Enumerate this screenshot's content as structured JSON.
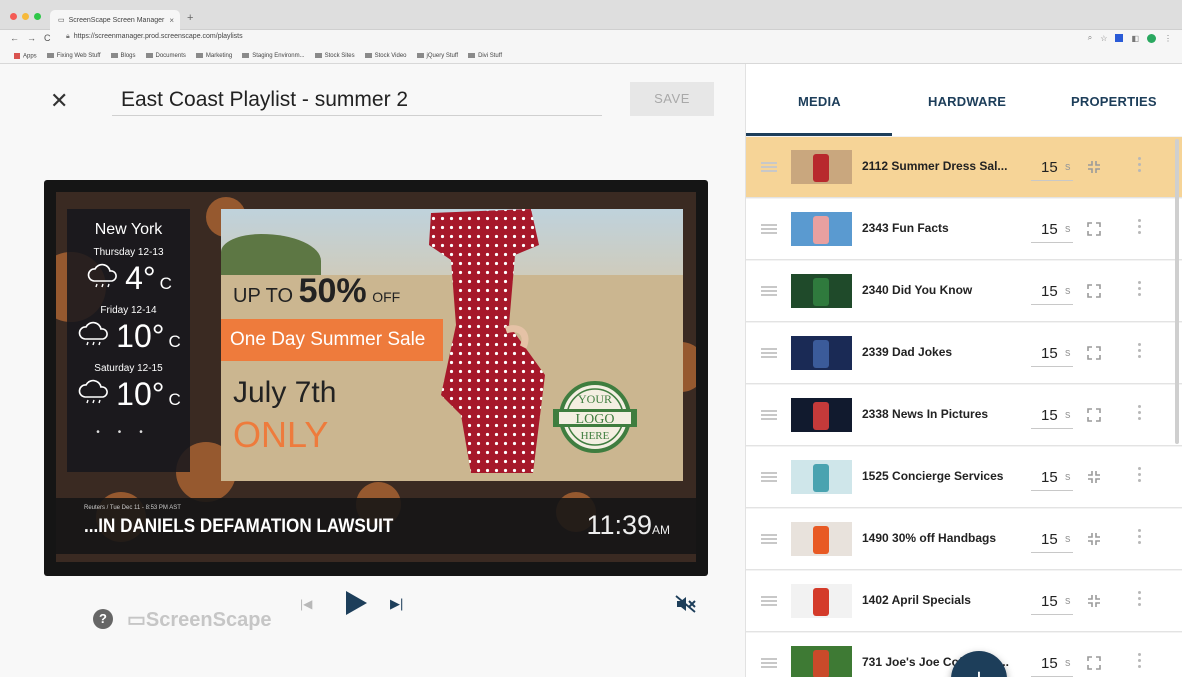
{
  "browser": {
    "tab_title": "ScreenScape Screen Manager",
    "url": "https://screenmanager.prod.screenscape.com/playlists",
    "bookmarks": [
      "Apps",
      "Fixing Web Stuff",
      "Blogs",
      "Documents",
      "Marketing",
      "Staging Environm...",
      "Stock Sites",
      "Stock Video",
      "jQuery Stuff",
      "Divi Stuff"
    ]
  },
  "editor": {
    "playlist_title": "East Coast Playlist - summer 2",
    "save_label": "SAVE"
  },
  "preview": {
    "weather": {
      "city": "New York",
      "days": [
        {
          "day": "Thursday 12-13",
          "temp": "4°",
          "unit": "C"
        },
        {
          "day": "Friday 12-14",
          "temp": "10°",
          "unit": "C"
        },
        {
          "day": "Saturday 12-15",
          "temp": "10°",
          "unit": "C"
        }
      ]
    },
    "ad": {
      "up_to": "UP TO",
      "percent": "50%",
      "off": "OFF",
      "band": "One Day Summer Sale",
      "date": "July 7th",
      "only": "ONLY",
      "logo_lines": [
        "YOUR",
        "LOGO",
        "HERE"
      ]
    },
    "ticker": {
      "source": "Reuters / Tue Dec 11 - 8:53 PM AST",
      "headline": "...IN DANIELS DEFAMATION LAWSUIT",
      "time": "11:39",
      "ampm": "AM"
    }
  },
  "player": {
    "brand": "ScreenScape"
  },
  "panel": {
    "tabs": [
      "MEDIA",
      "HARDWARE",
      "PROPERTIES"
    ],
    "items": [
      {
        "name": "2112 Summer Dress Sal...",
        "duration": "15",
        "unit": "s",
        "fit": "shrink",
        "active": true,
        "thumb": "#c9a77e",
        "accent": "#b8292d"
      },
      {
        "name": "2343 Fun Facts",
        "duration": "15",
        "unit": "s",
        "fit": "expand",
        "active": false,
        "thumb": "#5a9ad0",
        "accent": "#e8a0a0"
      },
      {
        "name": "2340 Did You Know",
        "duration": "15",
        "unit": "s",
        "fit": "expand",
        "active": false,
        "thumb": "#1f4a2a",
        "accent": "#2f7a3d"
      },
      {
        "name": "2339 Dad Jokes",
        "duration": "15",
        "unit": "s",
        "fit": "expand",
        "active": false,
        "thumb": "#1a2a55",
        "accent": "#3b5b9a"
      },
      {
        "name": "2338 News In Pictures",
        "duration": "15",
        "unit": "s",
        "fit": "expand",
        "active": false,
        "thumb": "#111a2e",
        "accent": "#c43a3a"
      },
      {
        "name": "1525 Concierge Services",
        "duration": "15",
        "unit": "s",
        "fit": "shrink",
        "active": false,
        "thumb": "#cfe6ea",
        "accent": "#4aa3b0"
      },
      {
        "name": "1490 30% off Handbags",
        "duration": "15",
        "unit": "s",
        "fit": "shrink",
        "active": false,
        "thumb": "#e8e2dc",
        "accent": "#e85a24"
      },
      {
        "name": "1402 April Specials",
        "duration": "15",
        "unit": "s",
        "fit": "shrink",
        "active": false,
        "thumb": "#f2f2f2",
        "accent": "#d43b2a"
      },
      {
        "name": "731 Joe's Joe Coffee Sh...",
        "duration": "15",
        "unit": "s",
        "fit": "expand",
        "active": false,
        "thumb": "#3e7a34",
        "accent": "#c94a2a"
      }
    ],
    "fab_label": "+"
  },
  "colors": {
    "primary": "#1d3e5a",
    "active_row": "#f6d497",
    "accent_orange": "#ee7b3c"
  }
}
